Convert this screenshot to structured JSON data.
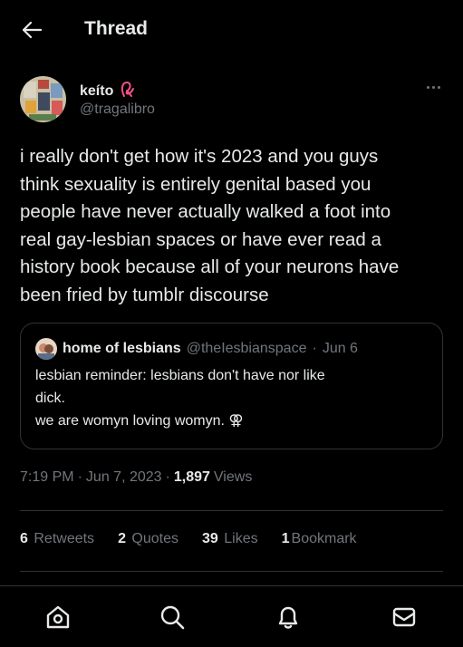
{
  "header": {
    "title": "Thread"
  },
  "tweet": {
    "author": {
      "name": "keíto",
      "handle": "@tragalibro"
    },
    "text": "i really don't get how it's 2023 and you guys\nthink sexuality is entirely genital based you\npeople have never actually walked a foot into\nreal gay-lesbian spaces or have ever read a\nhistory book because all of your neurons have\nbeen fried by tumblr discourse",
    "quote": {
      "name": "home of lesbians",
      "handle": "@theIesbianspace",
      "separator": "·",
      "date": "Jun 6",
      "text": "lesbian reminder: lesbians don't have nor like\ndick.\nwe are womyn loving womyn. ⚢"
    },
    "meta": {
      "time": "7:19 PM",
      "dot1": "·",
      "date": "Jun 7, 2023",
      "dot2": "·",
      "views_count": "1,897",
      "views_label": "Views"
    },
    "stats": {
      "retweets_count": "6",
      "retweets_label": "Retweets",
      "quotes_count": "2",
      "quotes_label": "Quotes",
      "likes_count": "39",
      "likes_label": "Likes",
      "bookmarks_count": "1",
      "bookmarks_label": "Bookmark"
    }
  },
  "colors": {
    "background": "#000000",
    "text": "#e7e9ea",
    "secondary": "#71767b",
    "border": "#2f3336",
    "accent_pink": "#f4518c"
  },
  "icons": [
    "back-arrow-icon",
    "more-icon",
    "home-icon",
    "search-icon",
    "bell-icon",
    "mail-icon"
  ]
}
